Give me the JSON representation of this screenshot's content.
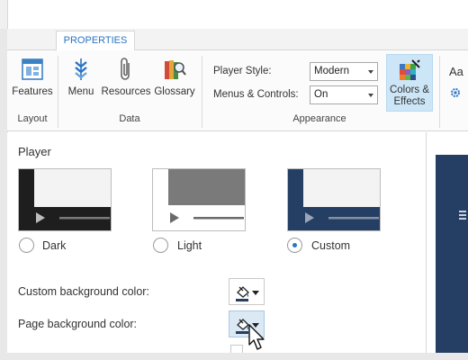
{
  "tabs": {
    "active": "PROPERTIES"
  },
  "ribbon": {
    "features_label": "Features",
    "menu_label": "Menu",
    "resources_label": "Resources",
    "glossary_label": "Glossary",
    "group_layout": "Layout",
    "group_data": "Data",
    "group_appearance": "Appearance",
    "player_style_label": "Player Style:",
    "player_style_value": "Modern",
    "menus_controls_label": "Menus & Controls:",
    "menus_controls_value": "On",
    "colors_effects_line1": "Colors &",
    "colors_effects_line2": "Effects",
    "cut_off_text": "Aa"
  },
  "player": {
    "title": "Player",
    "options": [
      {
        "label": "Dark",
        "selected": false
      },
      {
        "label": "Light",
        "selected": false
      },
      {
        "label": "Custom",
        "selected": true
      }
    ]
  },
  "props": {
    "custom_bg_label": "Custom background color:",
    "page_bg_label": "Page background color:"
  },
  "colors": {
    "accent": "#2a73c4",
    "navy": "#253e63",
    "dark_player": "#1e1e1e",
    "highlight": "#cde6f7"
  }
}
